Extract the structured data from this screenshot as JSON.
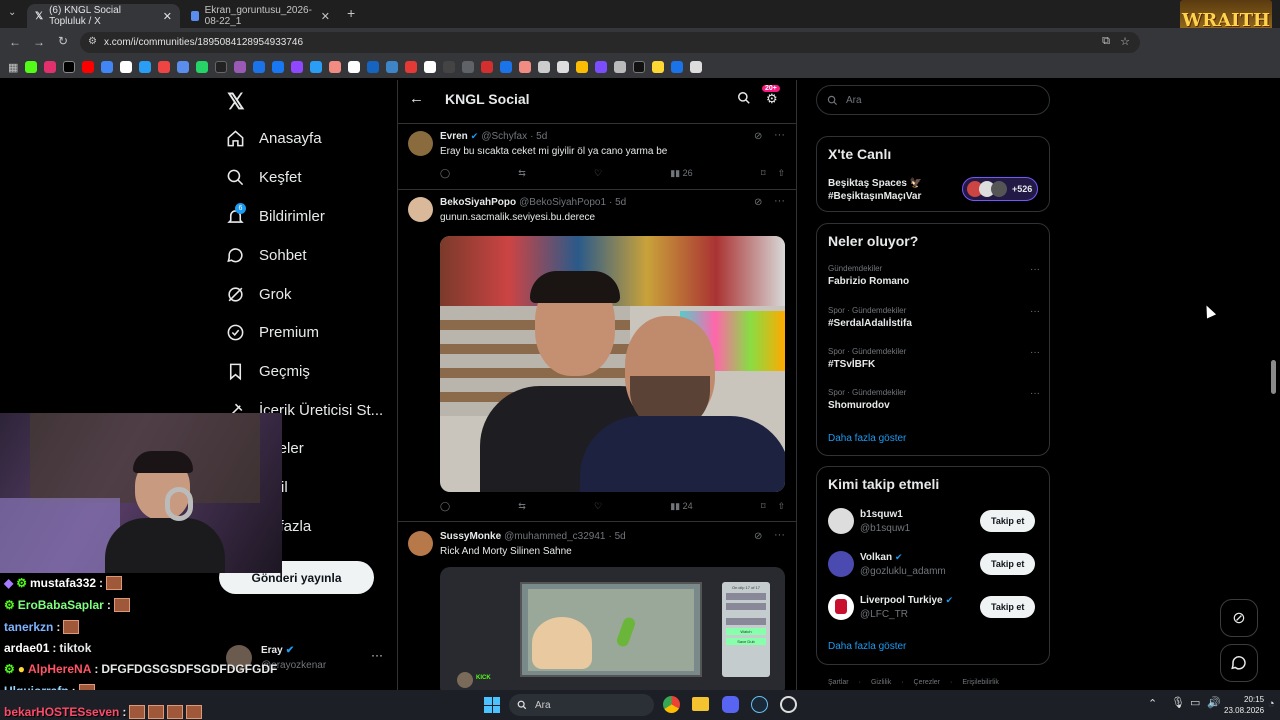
{
  "browser": {
    "tabs": [
      {
        "title": "(6) KNGL Social Topluluk / X",
        "active": true
      },
      {
        "title": "Ekran_goruntusu_2026-08-22_1",
        "active": false
      }
    ],
    "url": "x.com/i/communities/1895084128954933746",
    "overlay_logo": "WRAITH"
  },
  "sidebar": {
    "items": [
      {
        "label": "Anasayfa",
        "icon": "home-icon"
      },
      {
        "label": "Keşfet",
        "icon": "search-icon"
      },
      {
        "label": "Bildirimler",
        "icon": "bell-icon",
        "badge": "6"
      },
      {
        "label": "Sohbet",
        "icon": "chat-icon"
      },
      {
        "label": "Grok",
        "icon": "grok-icon"
      },
      {
        "label": "Premium",
        "icon": "premium-icon"
      },
      {
        "label": "Geçmiş",
        "icon": "bookmark-icon"
      },
      {
        "label": "İçerik Üreticisi St...",
        "icon": "creator-icon"
      },
      {
        "label": "aleler",
        "icon": "articles-icon"
      },
      {
        "label": "il",
        "icon": "profile-icon"
      },
      {
        "label": "a fazla",
        "icon": "more-icon"
      }
    ],
    "post_button": "Gönderi yayınla",
    "account": {
      "name": "Eray",
      "handle": "@erayozkenar"
    }
  },
  "feed": {
    "title": "KNGL Social",
    "badge": "20+",
    "tweets": [
      {
        "name": "Evren",
        "handle": "@Schyfax",
        "time": "· 5d",
        "text": "Eray bu sıcakta ceket mi giyilir öl ya cano yarma be",
        "views": "26"
      },
      {
        "name": "BekoSiyahPopo",
        "handle": "@BekoSiyahPopo1",
        "time": "· 5d",
        "text": "gunun.sacmalik.seviyesi.bu.derece",
        "views": "24"
      },
      {
        "name": "SussyMonke",
        "handle": "@muhammed_c32941",
        "time": "· 5d",
        "text": "Rick And Morty Silinen Sahne"
      }
    ],
    "video_menu": {
      "title": "On cilp 17 of 17",
      "items": [
        "",
        "",
        "",
        "Watch",
        "Save Dub",
        ""
      ]
    },
    "video_kick_label": "KICK"
  },
  "right": {
    "search_placeholder": "Ara",
    "live": {
      "title": "X'te Canlı",
      "line1": "Beşiktaş Spaces 🦅",
      "line2": "#BeşiktaşınMaçıVar",
      "count": "+526"
    },
    "trends": {
      "title": "Neler oluyor?",
      "items": [
        {
          "meta": "Gündemdekiler",
          "name": "Fabrizio Romano"
        },
        {
          "meta": "Spor · Gündemdekiler",
          "name": "#SerdalAdalıİstifa"
        },
        {
          "meta": "Spor · Gündemdekiler",
          "name": "#TSvİBFK"
        },
        {
          "meta": "Spor · Gündemdekiler",
          "name": "Shomurodov"
        }
      ],
      "more": "Daha fazla göster"
    },
    "who": {
      "title": "Kimi takip etmeli",
      "items": [
        {
          "name": "b1squw1",
          "handle": "@b1squw1",
          "verified": false
        },
        {
          "name": "Volkan",
          "handle": "@gozluklu_adamm",
          "verified": true
        },
        {
          "name": "Liverpool Turkiye",
          "handle": "@LFC_TR",
          "verified": true
        }
      ],
      "follow_label": "Takip et",
      "more": "Daha fazla göster"
    },
    "footer": [
      "Şartlar",
      "Gizlilik",
      "Çerezler",
      "Erişilebilirlik"
    ]
  },
  "chat": [
    {
      "user": "mustafa332",
      "color": "#ffffff",
      "text": ""
    },
    {
      "user": "EroBabaSaplar",
      "color": "#7fff7f",
      "text": ""
    },
    {
      "user": "tanerkzn",
      "color": "#7fb2ff",
      "text": ""
    },
    {
      "user": "ardae01",
      "color": "#ffffff",
      "text": "tiktok"
    },
    {
      "user": "AlpHereNA",
      "color": "#ff5566",
      "text": "DFGFDGSGSDFSGDFDGFGDF"
    },
    {
      "user": "Ulquiorrafn",
      "color": "#9ad4ff",
      "text": ""
    },
    {
      "user": "bekarHOSTESseven",
      "color": "#ff4a6a",
      "text": ""
    }
  ],
  "taskbar": {
    "search": "Ara",
    "time": "20:15",
    "date": "23.08.2026"
  }
}
